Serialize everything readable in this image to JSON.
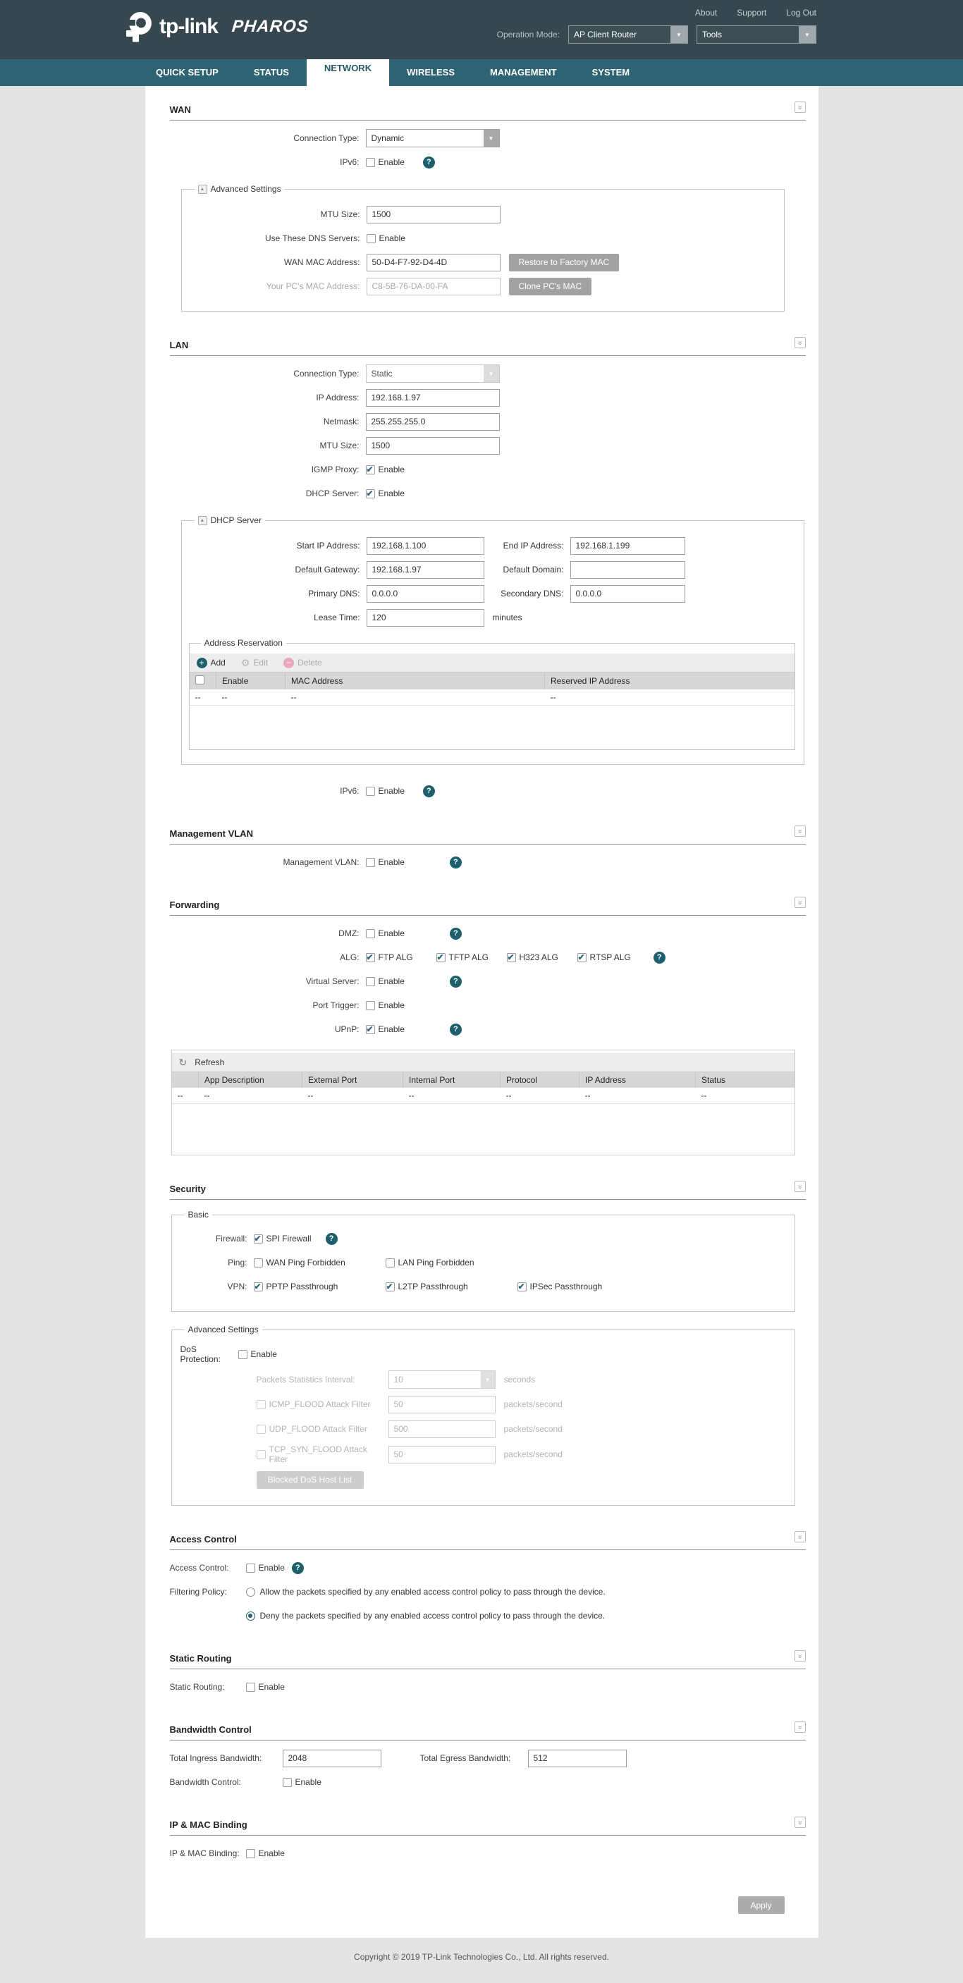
{
  "colors": {
    "accent": "#1e5f6e",
    "header-bg": "#37474f",
    "nav-bg": "#2e6373",
    "active-tab-text": "#2b5866",
    "delete-pink": "#eba7bf"
  },
  "icons": {
    "collapse_glyph": "»",
    "select_arrow_glyph": "▼",
    "legend_up_glyph": "▲",
    "help_glyph": "?",
    "add_glyph": "+",
    "edit_glyph": "⚙",
    "delete_glyph": "−",
    "refresh_glyph": "↻"
  },
  "header": {
    "brand": "tp-link",
    "product": "PHAROS",
    "links": [
      {
        "label": "About"
      },
      {
        "label": "Support"
      },
      {
        "label": "Log Out"
      }
    ],
    "operation_mode_label": "Operation Mode:",
    "operation_mode_value": "AP Client Router",
    "tools_value": "Tools"
  },
  "nav": {
    "tabs": [
      {
        "label": "QUICK SETUP"
      },
      {
        "label": "STATUS"
      },
      {
        "label": "NETWORK"
      },
      {
        "label": "WIRELESS"
      },
      {
        "label": "MANAGEMENT"
      },
      {
        "label": "SYSTEM"
      }
    ]
  },
  "common": {
    "enable": "Enable"
  },
  "wan": {
    "title": "WAN",
    "connection_type_label": "Connection Type:",
    "connection_type_value": "Dynamic",
    "ipv6_label": "IPv6:",
    "advanced": {
      "legend": "Advanced Settings",
      "mtu_label": "MTU Size:",
      "mtu_value": "1500",
      "dns_label": "Use These DNS Servers:",
      "wan_mac_label": "WAN MAC Address:",
      "wan_mac_value": "50-D4-F7-92-D4-4D",
      "restore_button": "Restore to Factory MAC",
      "pc_mac_label": "Your PC's MAC Address:",
      "pc_mac_value": "C8-5B-76-DA-00-FA",
      "clone_button": "Clone PC's MAC"
    }
  },
  "lan": {
    "title": "LAN",
    "connection_type_label": "Connection Type:",
    "connection_type_value": "Static",
    "ip_label": "IP Address:",
    "ip_value": "192.168.1.97",
    "netmask_label": "Netmask:",
    "netmask_value": "255.255.255.0",
    "mtu_label": "MTU Size:",
    "mtu_value": "1500",
    "igmp_label": "IGMP Proxy:",
    "dhcp_label": "DHCP Server:",
    "ipv6_label": "IPv6:",
    "dhcp": {
      "legend": "DHCP Server",
      "start_ip_label": "Start IP Address:",
      "start_ip_value": "192.168.1.100",
      "end_ip_label": "End IP Address:",
      "end_ip_value": "192.168.1.199",
      "gateway_label": "Default Gateway:",
      "gateway_value": "192.168.1.97",
      "domain_label": "Default Domain:",
      "domain_value": "",
      "primary_dns_label": "Primary DNS:",
      "primary_dns_value": "0.0.0.0",
      "secondary_dns_label": "Secondary DNS:",
      "secondary_dns_value": "0.0.0.0",
      "lease_label": "Lease Time:",
      "lease_value": "120",
      "lease_unit": "minutes",
      "reservation": {
        "legend": "Address Reservation",
        "toolbar": {
          "add": "Add",
          "edit": "Edit",
          "delete": "Delete"
        },
        "columns": [
          "Enable",
          "MAC Address",
          "Reserved IP Address"
        ],
        "rows": [
          [
            "--",
            "--",
            "--",
            "--"
          ]
        ]
      }
    }
  },
  "management_vlan": {
    "title": "Management VLAN",
    "label": "Management VLAN:"
  },
  "forwarding": {
    "title": "Forwarding",
    "dmz_label": "DMZ:",
    "alg_label": "ALG:",
    "alg_ftp": "FTP ALG",
    "alg_tftp": "TFTP ALG",
    "alg_h323": "H323 ALG",
    "alg_rtsp": "RTSP ALG",
    "virtual_server_label": "Virtual Server:",
    "port_trigger_label": "Port Trigger:",
    "upnp_label": "UPnP:",
    "table": {
      "refresh": "Refresh",
      "columns": [
        "App Description",
        "External Port",
        "Internal Port",
        "Protocol",
        "IP Address",
        "Status"
      ],
      "rows": [
        [
          "--",
          "--",
          "--",
          "--",
          "--",
          "--",
          "--"
        ]
      ]
    }
  },
  "security": {
    "title": "Security",
    "basic": {
      "legend": "Basic",
      "firewall_label": "Firewall:",
      "spi": "SPI Firewall",
      "ping_label": "Ping:",
      "wan_ping": "WAN Ping Forbidden",
      "lan_ping": "LAN Ping Forbidden",
      "vpn_label": "VPN:",
      "pptp": "PPTP Passthrough",
      "l2tp": "L2TP Passthrough",
      "ipsec": "IPSec Passthrough"
    },
    "advanced": {
      "legend": "Advanced Settings",
      "dos_label": "DoS Protection:",
      "interval_label": "Packets Statistics Interval:",
      "interval_value": "10",
      "interval_unit": "seconds",
      "icmp_label": "ICMP_FLOOD Attack Filter",
      "icmp_value": "50",
      "udp_label": "UDP_FLOOD Attack Filter",
      "udp_value": "500",
      "tcp_label": "TCP_SYN_FLOOD Attack Filter",
      "tcp_value": "50",
      "pps_unit": "packets/second",
      "blocked_button": "Blocked DoS Host List"
    }
  },
  "access_control": {
    "title": "Access Control",
    "label": "Access Control:",
    "filtering_label": "Filtering Policy:",
    "allow_text": "Allow the packets specified by any enabled access control policy to pass through the device.",
    "deny_text": "Deny the packets specified by any enabled access control policy to pass through the device."
  },
  "static_routing": {
    "title": "Static Routing",
    "label": "Static Routing:"
  },
  "bandwidth": {
    "title": "Bandwidth Control",
    "ingress_label": "Total Ingress Bandwidth:",
    "ingress_value": "2048",
    "egress_label": "Total Egress Bandwidth:",
    "egress_value": "512",
    "control_label": "Bandwidth Control:"
  },
  "ip_mac": {
    "title": "IP & MAC Binding",
    "label": "IP & MAC Binding:"
  },
  "apply_label": "Apply",
  "footer": "Copyright © 2019 TP-Link Technologies Co., Ltd. All rights reserved."
}
